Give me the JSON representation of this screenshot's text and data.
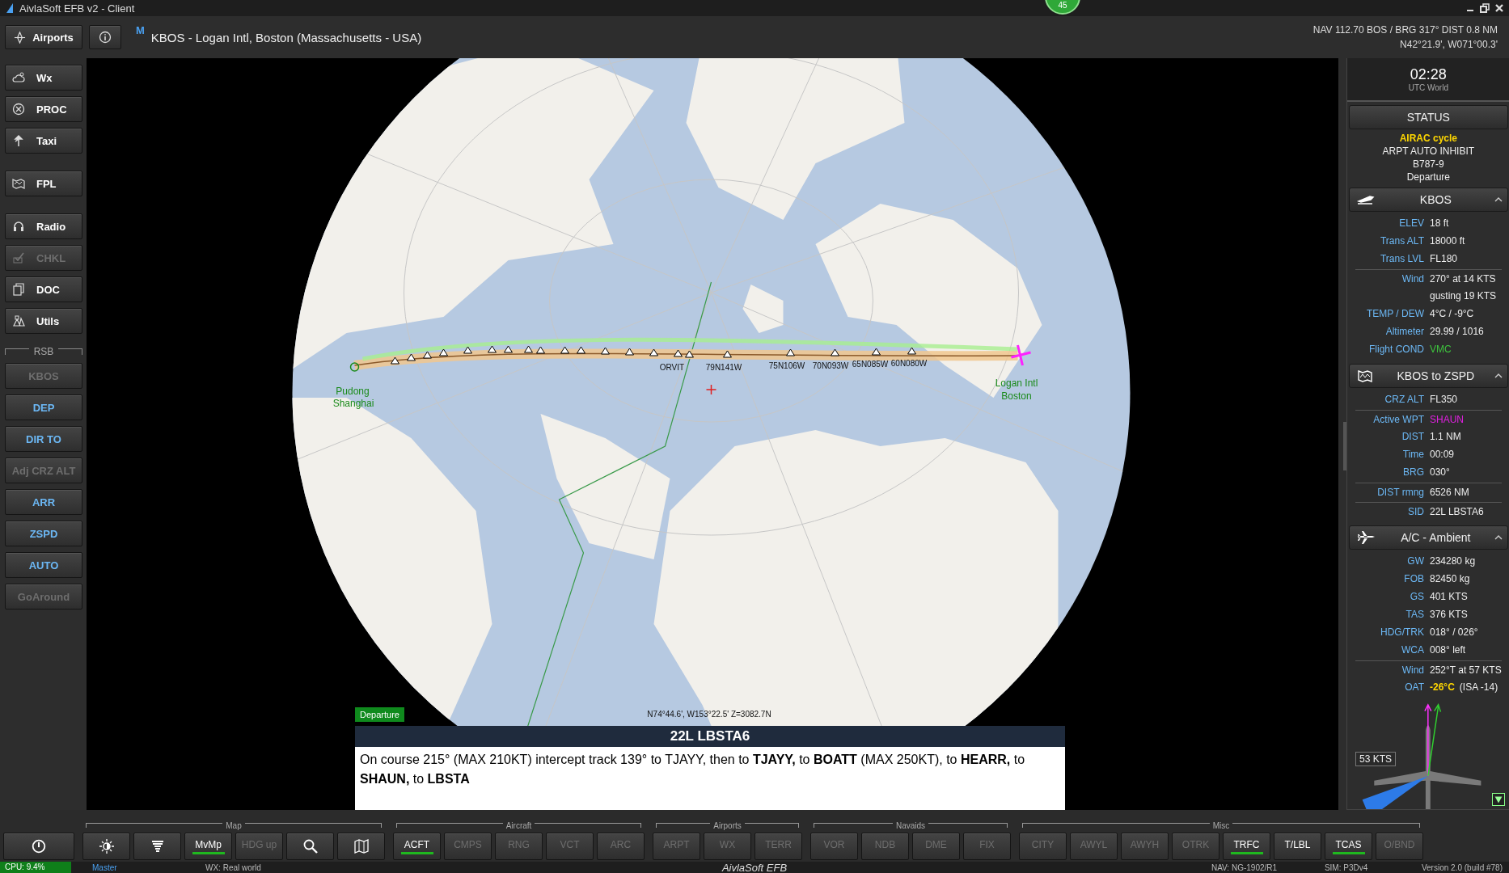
{
  "window": {
    "title": "AivlaSoft EFB v2 - Client",
    "badge": "45"
  },
  "header": {
    "airports_button": "Airports",
    "marker": "M",
    "airport_title": "KBOS - Logan Intl, Boston (Massachusetts - USA)",
    "nav_line": "NAV 112.70 BOS / BRG 317°  DIST 0.8 NM",
    "position_line": "N42°21.9', W071°00.3'"
  },
  "sidebar": {
    "buttons": [
      {
        "label": "Wx",
        "disabled": false
      },
      {
        "label": "PROC",
        "disabled": false
      },
      {
        "label": "Taxi",
        "disabled": false
      },
      {
        "label": "FPL",
        "disabled": false
      },
      {
        "label": "Radio",
        "disabled": false
      },
      {
        "label": "CHKL",
        "disabled": true
      },
      {
        "label": "DOC",
        "disabled": false
      },
      {
        "label": "Utils",
        "disabled": false
      }
    ],
    "rsb_label": "RSB",
    "rsb_buttons": [
      {
        "label": "KBOS",
        "disabled": true
      },
      {
        "label": "DEP",
        "disabled": false
      },
      {
        "label": "DIR TO",
        "disabled": false
      },
      {
        "label": "Adj CRZ ALT",
        "disabled": true
      },
      {
        "label": "ARR",
        "disabled": false
      },
      {
        "label": "ZSPD",
        "disabled": false
      },
      {
        "label": "AUTO",
        "disabled": false
      },
      {
        "label": "GoAround",
        "disabled": true
      }
    ]
  },
  "map": {
    "labels": [
      {
        "text": "ORVIT",
        "kind": "waypoint"
      },
      {
        "text": "79N141W",
        "kind": "waypoint"
      },
      {
        "text": "75N106W",
        "kind": "waypoint"
      },
      {
        "text": "70N093W",
        "kind": "waypoint"
      },
      {
        "text": "65N085W",
        "kind": "waypoint"
      },
      {
        "text": "60N080W",
        "kind": "waypoint"
      },
      {
        "text": "Pudong",
        "kind": "airport"
      },
      {
        "text": "Shanghai",
        "kind": "airport"
      },
      {
        "text": "Logan Intl",
        "kind": "airport"
      },
      {
        "text": "Boston",
        "kind": "airport"
      }
    ],
    "cursor_position": "N74°44.6', W153°22.5' Z=3082.7N",
    "phase_tag": "Departure",
    "procedure": {
      "title": "22L LBSTA6",
      "text": "On course 215° (MAX 210KT) intercept track 139° to TJAYY, then to **TJAYY,** to **BOATT** (MAX 250KT), to **HEARR,** to **SHAUN,** to **LBSTA**"
    }
  },
  "right_panel": {
    "clock": {
      "time": "02:28",
      "zone": "UTC World"
    },
    "status": {
      "title": "STATUS",
      "lines": [
        {
          "text": "AIRAC cycle",
          "color": "#ffd700"
        },
        {
          "text": "ARPT AUTO INHIBIT",
          "color": "#eeeeee"
        },
        {
          "text": "B787-9",
          "color": "#eeeeee"
        },
        {
          "text": "Departure",
          "color": "#eeeeee"
        }
      ]
    },
    "sections": [
      {
        "title": "KBOS",
        "kind": "airport",
        "expanded": true,
        "rows": [
          {
            "label": "ELEV",
            "value": "18 ft",
            "color": "#eeeeee",
            "divider_before": false
          },
          {
            "label": "Trans ALT",
            "value": "18000 ft",
            "color": "#eeeeee",
            "divider_before": false
          },
          {
            "label": "Trans LVL",
            "value": "FL180",
            "color": "#eeeeee",
            "divider_before": false
          },
          {
            "label": "Wind",
            "value": "270° at 14 KTS",
            "color": "#eeeeee",
            "divider_before": true
          },
          {
            "value": "gusting 19 KTS",
            "color": "#eeeeee",
            "divider_before": false
          },
          {
            "label": "TEMP / DEW",
            "value": "4°C  /  -9°C",
            "color": "#eeeeee",
            "divider_before": false
          },
          {
            "label": "Altimeter",
            "value": "29.99 / 1016",
            "color": "#eeeeee",
            "divider_before": false
          },
          {
            "label": "Flight COND",
            "value": "VMC",
            "color": "#3ec43e",
            "divider_before": false
          }
        ]
      },
      {
        "title": "KBOS to ZSPD",
        "kind": "route",
        "expanded": true,
        "rows": [
          {
            "label": "CRZ ALT",
            "value": "FL350",
            "color": "#eeeeee",
            "divider_before": false
          },
          {
            "label": "Active WPT",
            "value": "SHAUN",
            "color": "#e020e0",
            "divider_before": true
          },
          {
            "label": "DIST",
            "value": "1.1 NM",
            "color": "#eeeeee",
            "divider_before": false
          },
          {
            "label": "Time",
            "value": "00:09",
            "color": "#eeeeee",
            "divider_before": false
          },
          {
            "label": "BRG",
            "value": "030°",
            "color": "#eeeeee",
            "divider_before": false
          },
          {
            "label": "DIST rmng",
            "value": "6526 NM",
            "color": "#eeeeee",
            "divider_before": true
          },
          {
            "label": "SID",
            "value": "22L LBSTA6",
            "color": "#eeeeee",
            "divider_before": true
          }
        ]
      },
      {
        "title": "A/C - Ambient",
        "kind": "aircraft",
        "expanded": true,
        "rows": [
          {
            "label": "GW",
            "value": "234280 kg",
            "color": "#eeeeee",
            "divider_before": false
          },
          {
            "label": "FOB",
            "value": "82450 kg",
            "color": "#eeeeee",
            "divider_before": false
          },
          {
            "label": "GS",
            "value": "401 KTS",
            "color": "#eeeeee",
            "divider_before": false
          },
          {
            "label": "TAS",
            "value": "376 KTS",
            "color": "#eeeeee",
            "divider_before": false
          },
          {
            "label": "HDG/TRK",
            "value": "018° / 026°",
            "color": "#eeeeee",
            "divider_before": false
          },
          {
            "label": "WCA",
            "value": "008° left",
            "color": "#eeeeee",
            "divider_before": false
          },
          {
            "label": "Wind",
            "value": "252°T at 57 KTS",
            "color": "#eeeeee",
            "divider_before": true
          },
          {
            "label": "OAT",
            "value": "-26°C",
            "extra": "(ISA -14)",
            "color": "#ffd700",
            "divider_before": false
          }
        ]
      }
    ],
    "wind_speed": "53 KTS"
  },
  "toolbar": {
    "groups": [
      {
        "title": "Map",
        "buttons": [
          {
            "kind": "icon"
          },
          {
            "kind": "icon"
          },
          {
            "kind": "text",
            "label": "MvMp",
            "on": true,
            "disabled": false
          },
          {
            "kind": "text",
            "label": "HDG up",
            "on": false,
            "disabled": true
          },
          {
            "kind": "icon"
          },
          {
            "kind": "icon"
          }
        ]
      },
      {
        "title": "Aircraft",
        "buttons": [
          {
            "kind": "text",
            "label": "ACFT",
            "on": true,
            "disabled": false
          },
          {
            "kind": "text",
            "label": "CMPS",
            "on": false,
            "disabled": true
          },
          {
            "kind": "text",
            "label": "RNG",
            "on": false,
            "disabled": true
          },
          {
            "kind": "text",
            "label": "VCT",
            "on": false,
            "disabled": true
          },
          {
            "kind": "text",
            "label": "ARC",
            "on": false,
            "disabled": true
          }
        ]
      },
      {
        "title": "Airports",
        "buttons": [
          {
            "kind": "text",
            "label": "ARPT",
            "on": false,
            "disabled": true
          },
          {
            "kind": "text",
            "label": "WX",
            "on": false,
            "disabled": true
          },
          {
            "kind": "text",
            "label": "TERR",
            "on": false,
            "disabled": true
          }
        ]
      },
      {
        "title": "Navaids",
        "buttons": [
          {
            "kind": "text",
            "label": "VOR",
            "on": false,
            "disabled": true
          },
          {
            "kind": "text",
            "label": "NDB",
            "on": false,
            "disabled": true
          },
          {
            "kind": "text",
            "label": "DME",
            "on": false,
            "disabled": true
          },
          {
            "kind": "text",
            "label": "FIX",
            "on": false,
            "disabled": true
          }
        ]
      },
      {
        "title": "Misc",
        "buttons": [
          {
            "kind": "text",
            "label": "CITY",
            "on": false,
            "disabled": true
          },
          {
            "kind": "text",
            "label": "AWYL",
            "on": false,
            "disabled": true
          },
          {
            "kind": "text",
            "label": "AWYH",
            "on": false,
            "disabled": true
          },
          {
            "kind": "text",
            "label": "OTRK",
            "on": false,
            "disabled": true
          },
          {
            "kind": "text",
            "label": "TRFC",
            "on": true,
            "disabled": false
          },
          {
            "kind": "text",
            "label": "T/LBL",
            "on": false,
            "disabled": false
          },
          {
            "kind": "text",
            "label": "TCAS",
            "on": true,
            "disabled": false
          },
          {
            "kind": "text",
            "label": "O/BND",
            "on": false,
            "disabled": true
          }
        ]
      }
    ]
  },
  "status_bar": {
    "cpu": "CPU: 9.4%",
    "role": "Master",
    "weather": "WX: Real world",
    "brand": "AivlaSoft EFB",
    "nav": "NAV: NG-1902/R1",
    "sim": "SIM: P3Dv4",
    "version": "Version 2.0 (build #78)"
  }
}
